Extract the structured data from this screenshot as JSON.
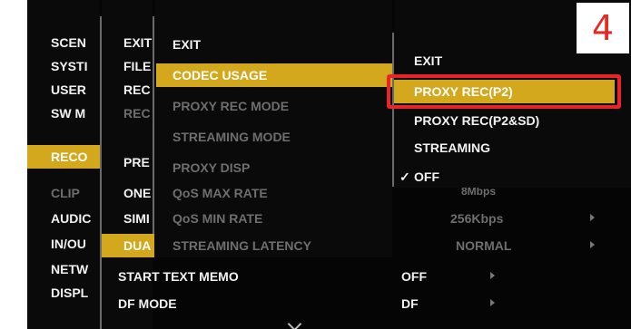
{
  "badge": "4",
  "menu_level1": [
    "SCEN",
    "SYSTI",
    "USER",
    "SW M",
    "RECO",
    "CLIP",
    "AUDIC",
    "IN/OU",
    "NETW",
    "DISPL"
  ],
  "menu_level2": [
    "EXIT",
    "FILE",
    "REC",
    "REC",
    "PRE",
    "ONE",
    "SIMI",
    "DUA",
    "START TEXT MEMO",
    "DF MODE"
  ],
  "menu_level3": [
    "EXIT",
    "CODEC USAGE",
    "PROXY REC MODE",
    "STREAMING MODE",
    "PROXY DISP",
    "QoS MAX RATE",
    "QoS MIN RATE",
    "STREAMING LATENCY"
  ],
  "menu_level4": [
    "EXIT",
    "PROXY REC(P2)",
    "PROXY REC(P2&SD)",
    "STREAMING",
    "OFF"
  ],
  "checked_mark": "✓",
  "values": {
    "qos_max": "8Mbps",
    "qos_min": "256Kbps",
    "latency": "NORMAL",
    "start_text_memo": "OFF",
    "df_mode": "DF"
  },
  "colors": {
    "selected": "#d4a81d",
    "highlight": "#e8242a"
  }
}
